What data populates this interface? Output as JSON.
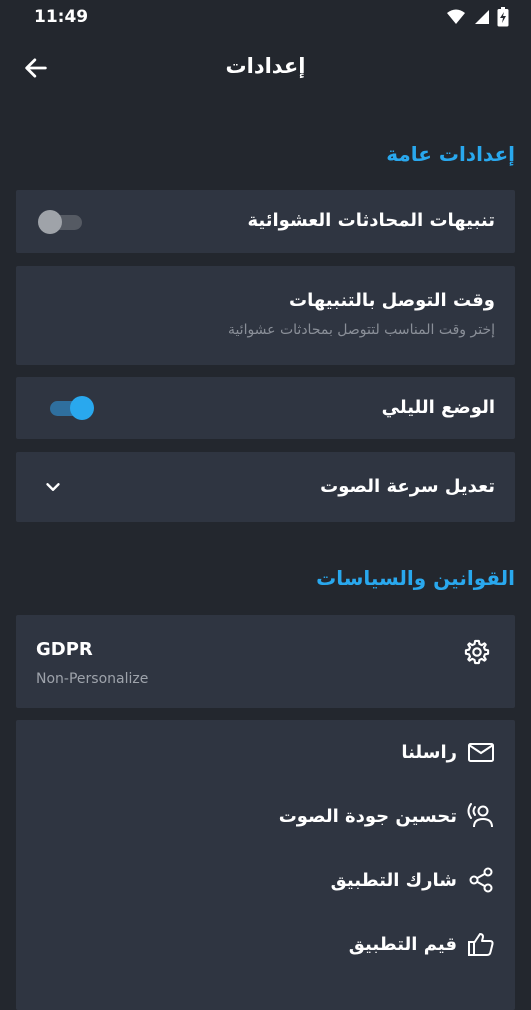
{
  "status": {
    "time": "11:49"
  },
  "appbar": {
    "title": "إعدادات"
  },
  "general": {
    "header": "إعدادات عامة",
    "random_notifications": {
      "label": "تنبيهات المحادثات العشوائية",
      "enabled": false
    },
    "notification_time": {
      "label": "وقت التوصل بالتنبيهات",
      "subtitle": "إختر وقت المناسب لتتوصل بمحادثات عشوائية"
    },
    "night_mode": {
      "label": "الوضع الليلي",
      "enabled": true
    },
    "voice_speed": {
      "label": "تعديل سرعة الصوت"
    }
  },
  "policies": {
    "header": "القوانين والسياسات",
    "gdpr": {
      "title": "GDPR",
      "subtitle": "Non-Personalize"
    },
    "menu": [
      {
        "label": "راسلنا",
        "icon": "mail-icon"
      },
      {
        "label": "تحسين جودة الصوت",
        "icon": "voice-person-icon"
      },
      {
        "label": "شارك التطبيق",
        "icon": "share-icon"
      },
      {
        "label": "قيم التطبيق",
        "icon": "thumb-up-icon"
      }
    ]
  },
  "colors": {
    "accent": "#29a8ee",
    "background": "#23272e",
    "card": "#2f3541"
  }
}
